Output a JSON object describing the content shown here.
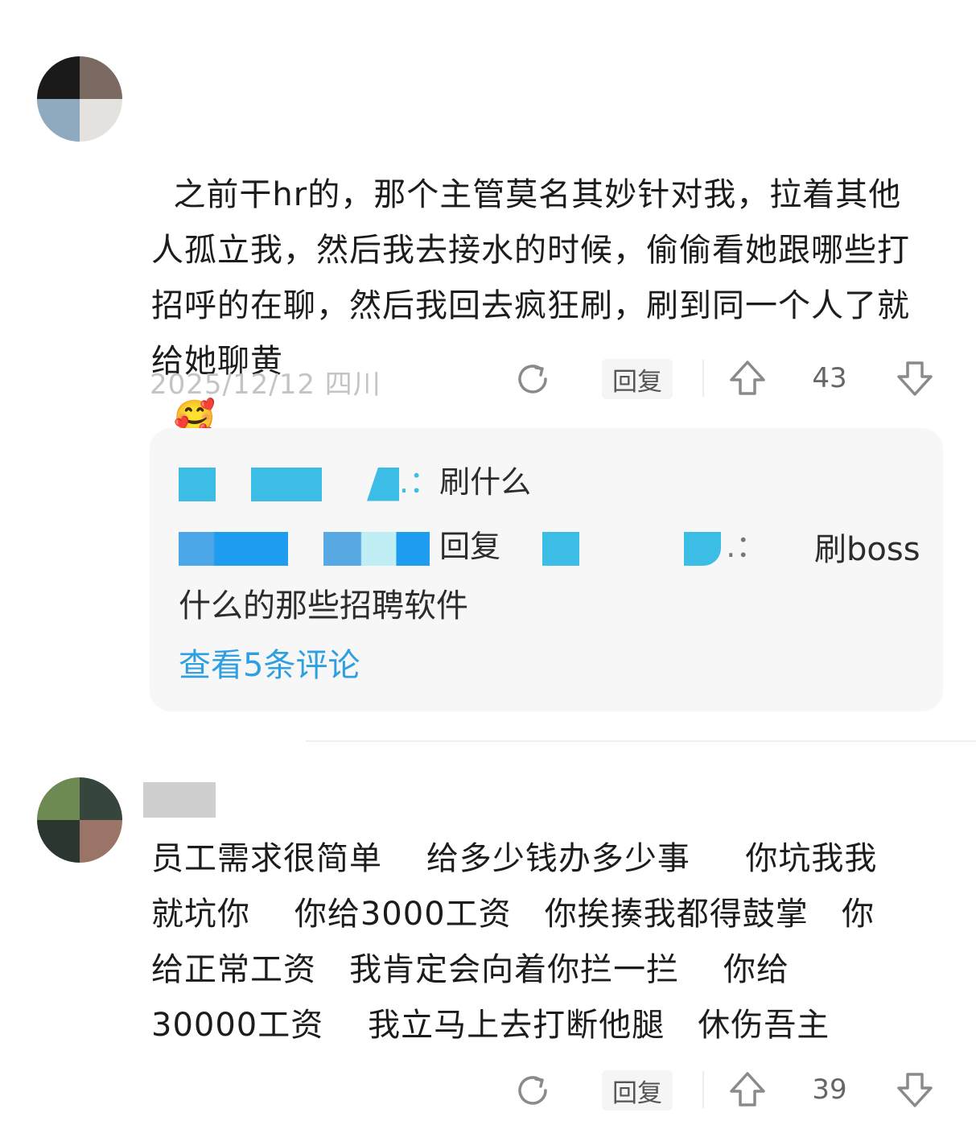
{
  "comments": [
    {
      "text": "之前干hr的，那个主管莫名其妙针对我，拉着其他人孤立我，然后我去接水的时候，偷偷看她跟哪些打招呼的在聊，然后我回去疯狂刷，刷到同一个人了就给她聊黄",
      "emoji": "🥰",
      "meta": "2025/12/12 四川",
      "reply_label": "回复",
      "like_count": "43",
      "replies": [
        {
          "separator": ".：",
          "text": "刷什么"
        },
        {
          "reply_word": "回复",
          "separator": ".：",
          "text": "刷boss 什么的那些招聘软件"
        }
      ],
      "view_more": "查看5条评论"
    },
    {
      "lines": [
        "员工需求很简单    给多少钱办多少事     你坑我我",
        "就坑你    你给3000工资   你挨揍我都得鼓掌   你",
        "给正常工资   我肯定会向着你拦一拦    你给",
        "30000工资    我立马上去打断他腿   休伤吾主"
      ],
      "reply_label": "回复",
      "like_count": "39"
    }
  ],
  "colors": {
    "link": "#2e9fe0",
    "mask_blue": "#3bbde6",
    "mask_blue_dark": "#1e9cf0",
    "meta": "#c4c4c4"
  },
  "icons": [
    "share-icon",
    "upvote-icon",
    "downvote-icon"
  ]
}
